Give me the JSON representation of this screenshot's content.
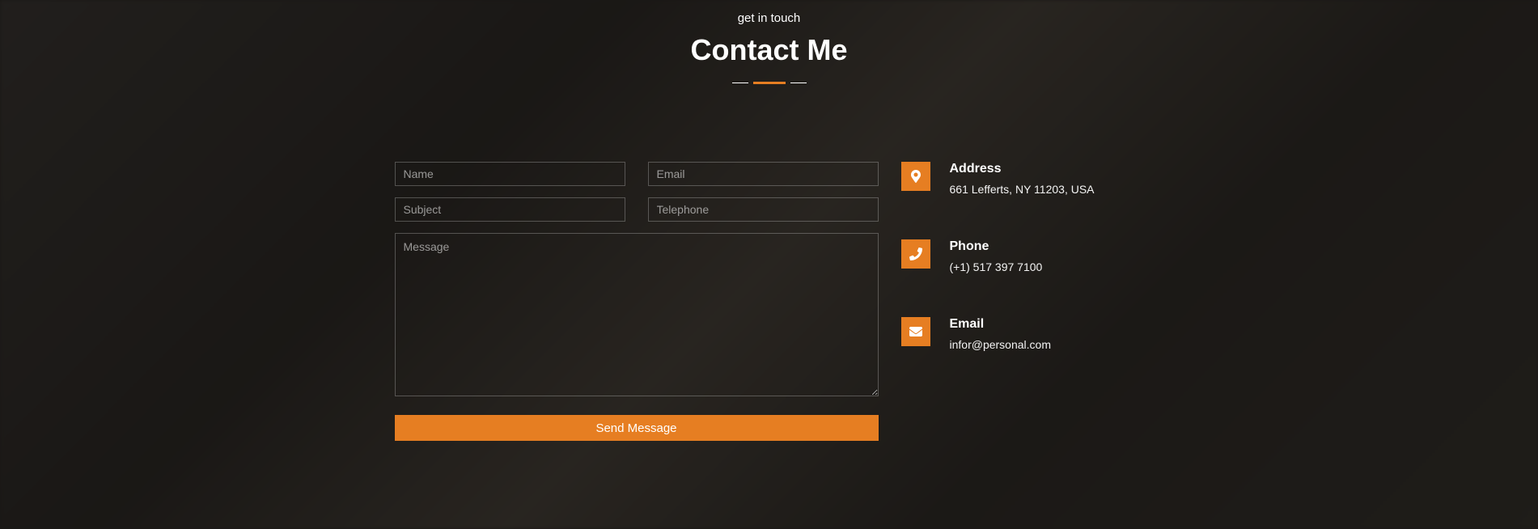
{
  "header": {
    "subtitle": "get in touch",
    "title": "Contact Me"
  },
  "form": {
    "name_placeholder": "Name",
    "email_placeholder": "Email",
    "subject_placeholder": "Subject",
    "telephone_placeholder": "Telephone",
    "message_placeholder": "Message",
    "submit_label": "Send Message"
  },
  "info": {
    "address": {
      "label": "Address",
      "value": "661 Lefferts, NY 11203, USA"
    },
    "phone": {
      "label": "Phone",
      "value": "(+1) 517 397 7100"
    },
    "email": {
      "label": "Email",
      "value": "infor@personal.com"
    }
  }
}
